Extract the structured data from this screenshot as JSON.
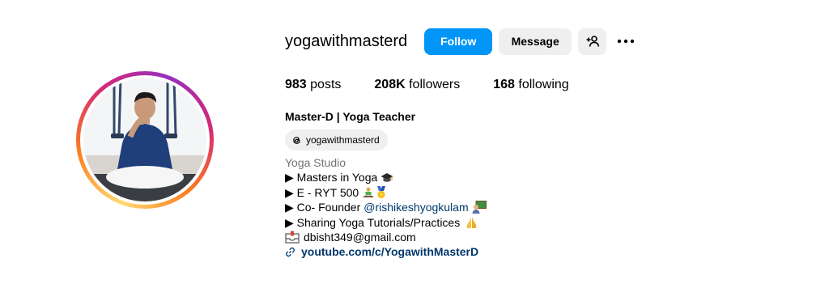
{
  "profile": {
    "username": "yogawithmasterd",
    "follow_label": "Follow",
    "message_label": "Message",
    "full_name": "Master-D | Yoga Teacher",
    "threads_handle": "yogawithmasterd"
  },
  "stats": {
    "posts_count": "983",
    "posts_label": "posts",
    "followers_count": "208K",
    "followers_label": "followers",
    "following_count": "168",
    "following_label": "following"
  },
  "bio": {
    "category": "Yoga Studio",
    "line1": "▶ Masters in Yoga",
    "line2": "▶ E - RYT 500",
    "line3_prefix": "▶ Co- Founder ",
    "line3_mention": "@rishikeshyogkulam",
    "line4": "▶ Sharing Yoga Tutorials/Practices",
    "email": "dbisht349@gmail.com",
    "link": "youtube.com/c/YogawithMasterD"
  },
  "colors": {
    "follow_blue": "#0095f6",
    "button_gray": "#efefef",
    "link_blue": "#00376b",
    "category_gray": "#737373"
  },
  "icons": [
    "add-user-icon",
    "more-options-icon",
    "threads-icon",
    "graduation-cap-icon",
    "meditation-icon",
    "medal-icon",
    "teacher-icon",
    "folded-hands-icon",
    "inbox-icon",
    "link-icon"
  ]
}
